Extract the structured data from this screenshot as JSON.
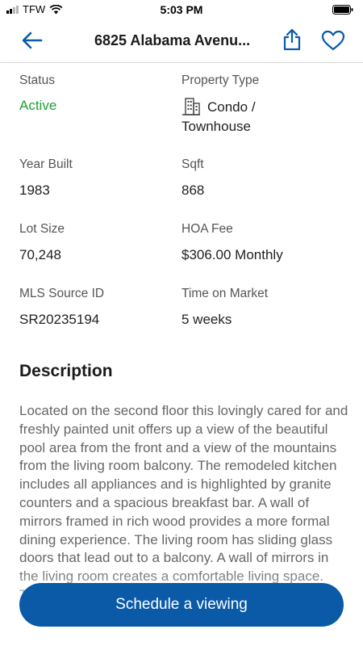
{
  "status_bar": {
    "carrier": "TFW",
    "time": "5:03 PM"
  },
  "nav": {
    "title": "6825 Alabama Avenu...",
    "icons": [
      "back-arrow-icon",
      "share-icon",
      "heart-icon"
    ],
    "accent_color": "#0a5aa8"
  },
  "facts": {
    "status": {
      "label": "Status",
      "value": "Active",
      "value_color": "#1fa03a"
    },
    "property_type": {
      "label": "Property Type",
      "value_line1": "Condo /",
      "value_line2": "Townhouse",
      "icon": "building-icon"
    },
    "year_built": {
      "label": "Year Built",
      "value": "1983"
    },
    "sqft": {
      "label": "Sqft",
      "value": "868"
    },
    "lot_size": {
      "label": "Lot Size",
      "value": "70,248"
    },
    "hoa_fee": {
      "label": "HOA Fee",
      "value": "$306.00 Monthly"
    },
    "mls_id": {
      "label": "MLS Source ID",
      "value": "SR20235194"
    },
    "time_on_market": {
      "label": "Time on Market",
      "value": "5 weeks"
    }
  },
  "description": {
    "title": "Description",
    "text": "Located on the second floor this lovingly cared for and freshly painted unit offers up a view of the beautiful pool area from the front and a view of the mountains from the living room balcony. The remodeled kitchen includes all appliances and is highlighted by granite counters and a spacious breakfast bar. A wall of mirrors framed in rich wood provides a more formal dining experience.  The living room has sliding glass doors that lead out to a balcony. A wall of mirrors in the living room creates a comfortable living space.  The"
  },
  "cta": {
    "label": "Schedule a viewing"
  }
}
